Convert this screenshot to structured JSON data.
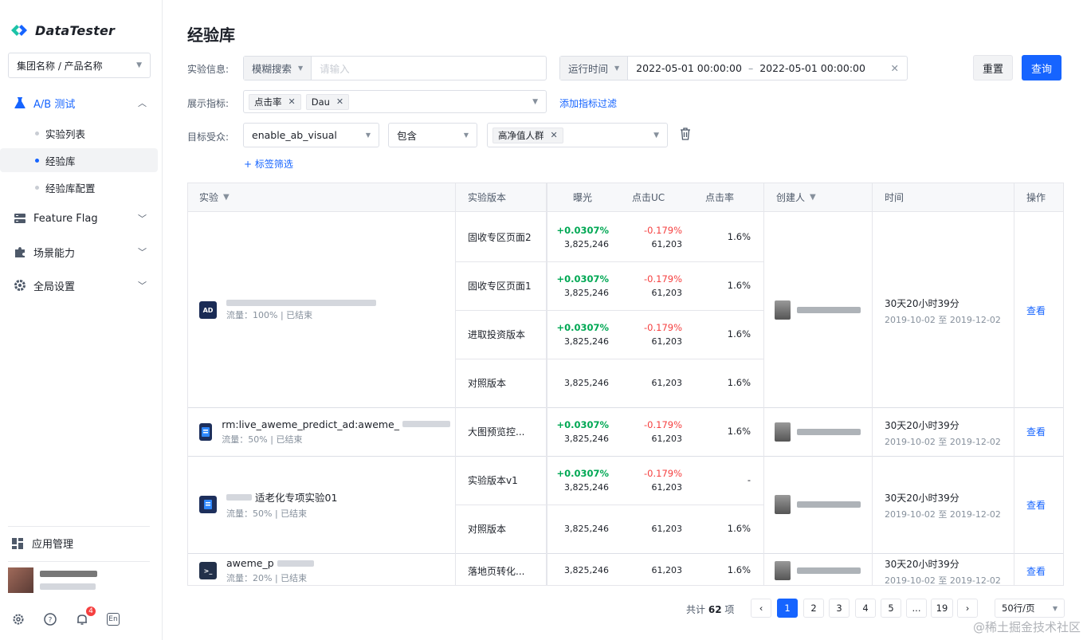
{
  "app": {
    "name": "DataTester"
  },
  "sidebar": {
    "group_select": "集团名称 / 产品名称",
    "nav": [
      {
        "label": "A/B 测试",
        "icon": "flask-icon"
      },
      {
        "label": "Feature Flag",
        "icon": "flag-icon"
      },
      {
        "label": "场景能力",
        "icon": "puzzle-icon"
      },
      {
        "label": "全局设置",
        "icon": "gear-icon"
      }
    ],
    "sub": [
      "实验列表",
      "经验库",
      "经验库配置"
    ],
    "app_mgmt": "应用管理",
    "notifications": "4",
    "lang": "En"
  },
  "page": {
    "title": "经验库"
  },
  "filters": {
    "exp_info_label": "实验信息:",
    "search_mode": "模糊搜索",
    "search_placeholder": "请输入",
    "time_mode": "运行时间",
    "time_start": "2022-05-01 00:00:00",
    "time_sep": "–",
    "time_end": "2022-05-01 00:00:00",
    "metric_label": "展示指标:",
    "metric_tags": [
      "点击率",
      "Dau"
    ],
    "add_metric_filter": "添加指标过滤",
    "audience_label": "目标受众:",
    "audience_field": "enable_ab_visual",
    "audience_op": "包含",
    "audience_tags": [
      "高净值人群"
    ],
    "tag_filter": "+ 标签筛选",
    "reset": "重置",
    "query": "查询"
  },
  "table": {
    "headers": {
      "experiment": "实验",
      "version": "实验版本",
      "exposure": "曝光",
      "click_uc": "点击UC",
      "ctr": "点击率",
      "creator": "创建人",
      "time": "时间",
      "action": "操作"
    },
    "rows": [
      {
        "name": "",
        "meta": "流量：100%  |  已结束",
        "icon_text": "AD",
        "time": "30天20小时39分",
        "range": "2019-10-02 至 2019-12-02",
        "action": "查看",
        "versions": [
          {
            "name": "固收专区页面2",
            "exp_delta": "+0.0307%",
            "exposure": "3,825,246",
            "uc_delta": "-0.179%",
            "uc": "61,203",
            "ctr": "1.6%"
          },
          {
            "name": "固收专区页面1",
            "exp_delta": "+0.0307%",
            "exposure": "3,825,246",
            "uc_delta": "-0.179%",
            "uc": "61,203",
            "ctr": "1.6%"
          },
          {
            "name": "进取投资版本",
            "exp_delta": "+0.0307%",
            "exposure": "3,825,246",
            "uc_delta": "-0.179%",
            "uc": "61,203",
            "ctr": "1.6%"
          },
          {
            "name": "对照版本",
            "exp_delta": "",
            "exposure": "3,825,246",
            "uc_delta": "",
            "uc": "61,203",
            "ctr": "1.6%"
          }
        ]
      },
      {
        "name": "rm:live_aweme_predict_ad:aweme_",
        "meta": "流量：50%  |  已结束",
        "icon_text": "",
        "time": "30天20小时39分",
        "range": "2019-10-02 至 2019-12-02",
        "action": "查看",
        "versions": [
          {
            "name": "大图预览控...",
            "exp_delta": "+0.0307%",
            "exposure": "3,825,246",
            "uc_delta": "-0.179%",
            "uc": "61,203",
            "ctr": "1.6%"
          }
        ]
      },
      {
        "name": "适老化专项实验01",
        "meta": "流量：50%  |  已结束",
        "icon_text": "",
        "time": "30天20小时39分",
        "range": "2019-10-02 至 2019-12-02",
        "action": "查看",
        "versions": [
          {
            "name": "实验版本v1",
            "exp_delta": "+0.0307%",
            "exposure": "3,825,246",
            "uc_delta": "-0.179%",
            "uc": "61,203",
            "ctr": "-"
          },
          {
            "name": "对照版本",
            "exp_delta": "",
            "exposure": "3,825,246",
            "uc_delta": "",
            "uc": "61,203",
            "ctr": "1.6%"
          }
        ]
      },
      {
        "name": "aweme_p",
        "meta": "流量：20%  |  已结束",
        "icon_text": ">_",
        "time": "30天20小时39分",
        "range": "2019-10-02 至 2019-12-02",
        "action": "查看",
        "versions": [
          {
            "name": "落地页转化...",
            "exp_delta": "",
            "exposure": "3,825,246",
            "uc_delta": "",
            "uc": "61,203",
            "ctr": "1.6%"
          }
        ]
      }
    ]
  },
  "pagination": {
    "total_prefix": "共计",
    "total": "62",
    "total_suffix": "项",
    "pages": [
      "1",
      "2",
      "3",
      "4",
      "5",
      "...",
      "19"
    ],
    "current": "1",
    "page_size": "50行/页"
  },
  "watermark": "@稀土掘金技术社区",
  "colors": {
    "accent": "#1664ff",
    "positive": "#00a854",
    "negative": "#f53f3f"
  }
}
